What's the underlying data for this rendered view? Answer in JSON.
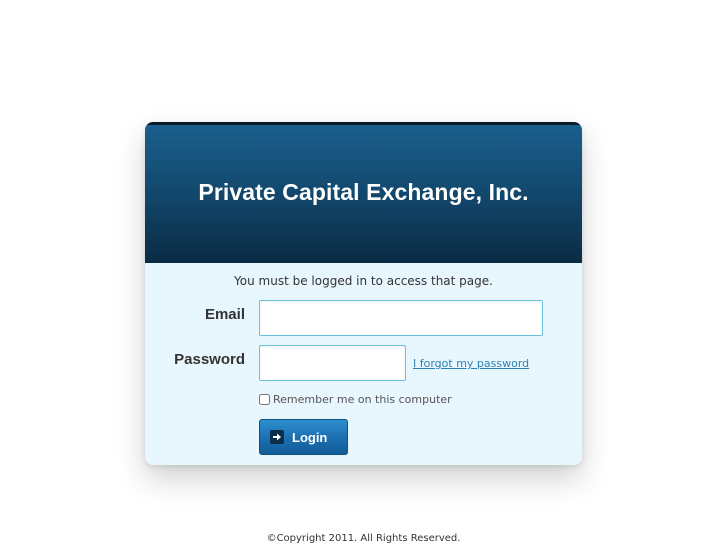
{
  "header": {
    "title": "Private Capital Exchange, Inc."
  },
  "login": {
    "notice": "You must be logged in to access that page.",
    "email_label": "Email",
    "email_value": "",
    "password_label": "Password",
    "password_value": "",
    "forgot_link": "I forgot my password",
    "remember_label": "Remember me on this computer",
    "remember_checked": false,
    "submit_label": "Login",
    "submit_icon": "arrow-right-icon"
  },
  "footer": {
    "copyright": "©Copyright 2011. All Rights Reserved."
  },
  "colors": {
    "header_top": "#1b5f8d",
    "header_bottom": "#0a2b44",
    "body_background": "#e8f6fd",
    "input_border": "#6cc0dc",
    "link": "#2a83b7",
    "button": "#1b6fb0"
  }
}
